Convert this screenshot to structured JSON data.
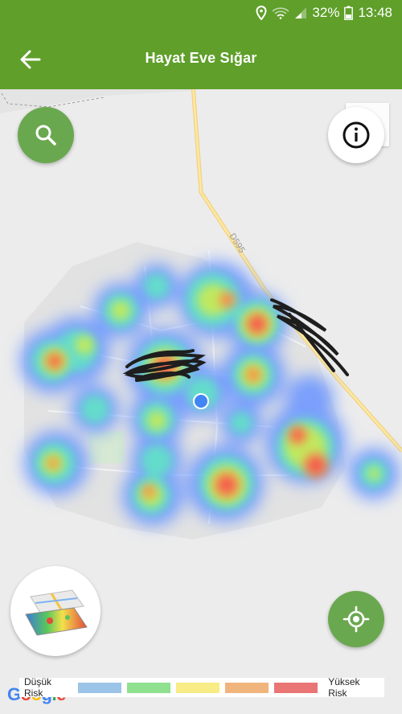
{
  "status_bar": {
    "battery_percent": "32%",
    "time": "13:48",
    "icons": [
      "location-icon",
      "wifi-icon",
      "signal-icon",
      "battery-icon"
    ]
  },
  "app_bar": {
    "title": "Hayat Eve Sığar",
    "back_icon": "arrow-left-icon"
  },
  "map": {
    "road_label": "D595",
    "heatmap_visible": true
  },
  "buttons": {
    "search_icon": "search-icon",
    "info_icon": "info-icon",
    "layers_icon": "map-layers-icon",
    "my_location_icon": "my-location-icon"
  },
  "legend": {
    "low_label": "Düşük Risk",
    "high_label": "Yüksek Risk",
    "colors": [
      "#9cc4e8",
      "#8fe08f",
      "#f7ec85",
      "#f0b47d",
      "#e97575"
    ]
  },
  "attribution": "Google",
  "colors": {
    "accent": "#5f9f2a",
    "fab_green": "#6aa84f"
  }
}
